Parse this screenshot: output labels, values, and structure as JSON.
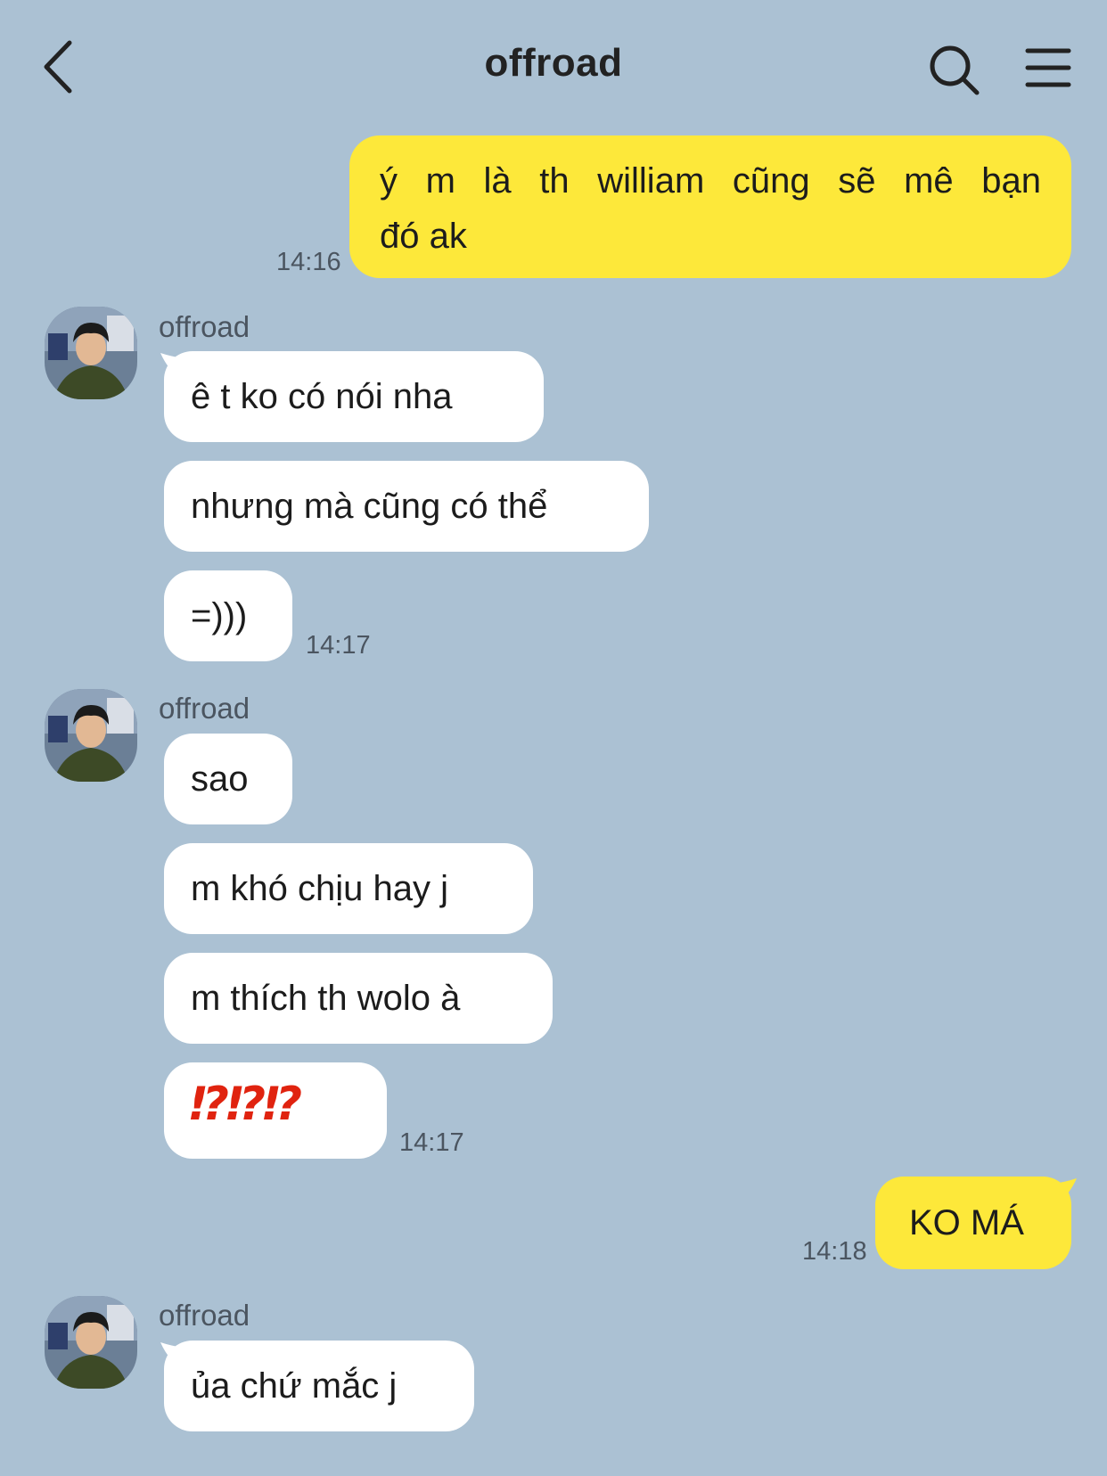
{
  "header": {
    "title": "offroad",
    "back_icon": "chevron-left-icon",
    "search_icon": "search-icon",
    "menu_icon": "hamburger-menu-icon"
  },
  "colors": {
    "background": "#abc1d3",
    "outgoing_bubble": "#fde83a",
    "incoming_bubble": "#ffffff",
    "timestamp": "#4b5560",
    "emoji_red": "#e0230f"
  },
  "messages": {
    "m1": {
      "text_line1": "ý m là th william cũng sẽ mê bạn",
      "text_line2": "đó ak",
      "time": "14:16"
    },
    "group1": {
      "sender": "offroad",
      "b1": "ê t ko có nói nha",
      "b2": "nhưng mà cũng có thể",
      "b3": "=)))",
      "time": "14:17"
    },
    "group2": {
      "sender": "offroad",
      "b1": "sao",
      "b2": "m khó chịu hay j",
      "b3": "m thích th wolo à",
      "b4": "⁉⁉⁉",
      "time": "14:17"
    },
    "m_out2": {
      "text": "KO MÁ",
      "time": "14:18"
    },
    "group3": {
      "sender": "offroad",
      "b1": "ủa chứ mắc j"
    }
  }
}
